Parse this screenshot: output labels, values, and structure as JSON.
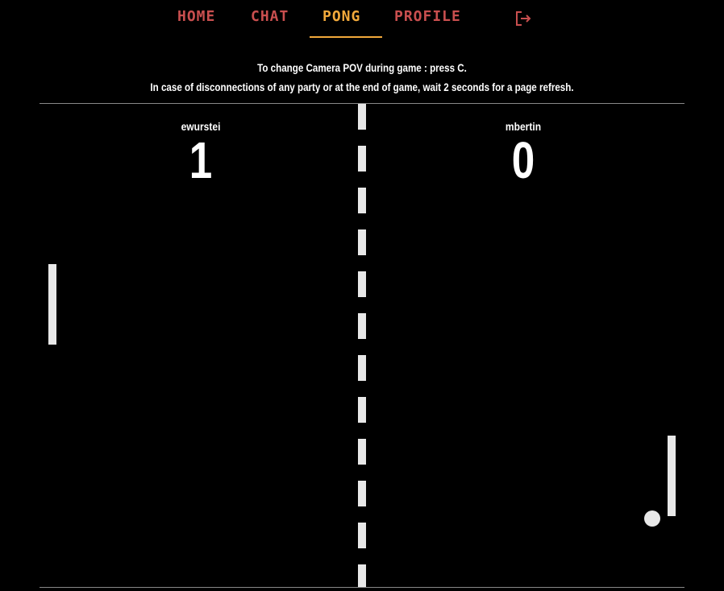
{
  "nav": {
    "items": [
      {
        "label": "HOME",
        "active": false
      },
      {
        "label": "CHAT",
        "active": false
      },
      {
        "label": "PONG",
        "active": true
      },
      {
        "label": "PROFILE",
        "active": false
      }
    ],
    "logout_icon": "logout-icon"
  },
  "info": {
    "line1": "To change Camera POV during game : press C.",
    "line2": "In case of disconnections of any party or at the end of game, wait 2 seconds for a page refresh."
  },
  "game": {
    "left_player": {
      "name": "ewurstei",
      "score": "1"
    },
    "right_player": {
      "name": "mbertin",
      "score": "0"
    }
  },
  "colors": {
    "nav_inactive": "#c94f4f",
    "nav_active": "#f2a93b",
    "background": "#000000",
    "game_elements": "#e8e8e8"
  }
}
